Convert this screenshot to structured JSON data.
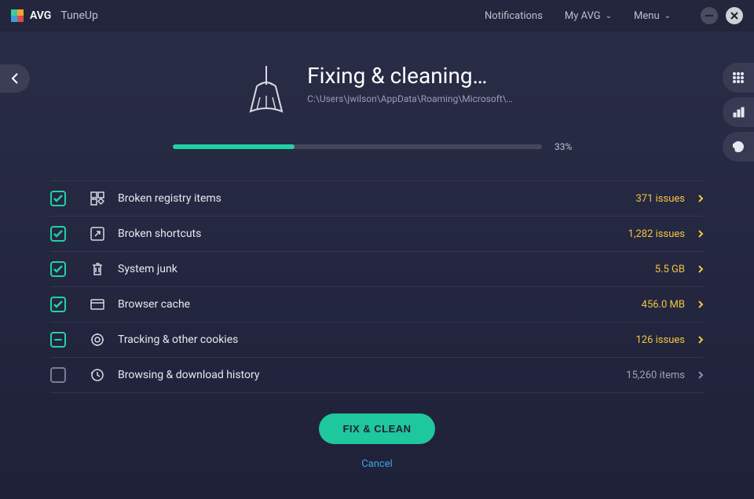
{
  "app": {
    "brand": "AVG",
    "product": "TuneUp"
  },
  "header": {
    "notifications": "Notifications",
    "myavg": "My AVG",
    "menu": "Menu"
  },
  "hero": {
    "title": "Fixing & cleaning…",
    "path": "C:\\Users\\jwilson\\AppData\\Roaming\\Microsoft\\…"
  },
  "progress": {
    "percent_label": "33%",
    "percent_value": 33
  },
  "categories": [
    {
      "label": "Broken registry items",
      "count": "371 issues",
      "state": "checked",
      "warn": true,
      "icon": "registry"
    },
    {
      "label": "Broken shortcuts",
      "count": "1,282 issues",
      "state": "checked",
      "warn": true,
      "icon": "shortcut"
    },
    {
      "label": "System junk",
      "count": "5.5 GB",
      "state": "checked",
      "warn": true,
      "icon": "trash"
    },
    {
      "label": "Browser cache",
      "count": "456.0 MB",
      "state": "checked",
      "warn": true,
      "icon": "browser"
    },
    {
      "label": "Tracking & other cookies",
      "count": "126 issues",
      "state": "partial",
      "warn": true,
      "icon": "tracking"
    },
    {
      "label": "Browsing & download history",
      "count": "15,260 items",
      "state": "unchecked",
      "warn": false,
      "icon": "history"
    }
  ],
  "actions": {
    "fix": "FIX & CLEAN",
    "cancel": "Cancel"
  },
  "colors": {
    "accent": "#21d1a4",
    "warn": "#f5c542",
    "link": "#3da3e8"
  }
}
